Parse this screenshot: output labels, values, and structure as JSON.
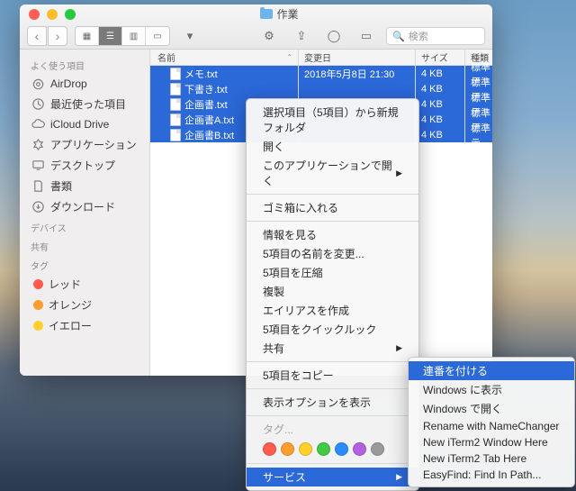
{
  "window": {
    "title": "作業"
  },
  "search": {
    "placeholder": "検索"
  },
  "sidebar": {
    "sections": [
      {
        "header": "よく使う項目",
        "items": [
          {
            "label": "AirDrop"
          },
          {
            "label": "最近使った項目"
          },
          {
            "label": "iCloud Drive"
          },
          {
            "label": "アプリケーション"
          },
          {
            "label": "デスクトップ"
          },
          {
            "label": "書類"
          },
          {
            "label": "ダウンロード"
          }
        ]
      },
      {
        "header": "デバイス",
        "items": []
      },
      {
        "header": "共有",
        "items": []
      },
      {
        "header": "タグ",
        "items": [
          {
            "label": "レッド",
            "color": "#ff5c4d"
          },
          {
            "label": "オレンジ",
            "color": "#ff9d2e"
          },
          {
            "label": "イエロー",
            "color": "#ffd02e"
          }
        ]
      }
    ]
  },
  "columns": {
    "name": "名前",
    "date": "変更日",
    "size": "サイズ",
    "kind": "種類"
  },
  "files": [
    {
      "name": "メモ.txt",
      "date": "2018年5月8日 21:30",
      "size": "4 KB",
      "kind": "標準テ"
    },
    {
      "name": "下書き.txt",
      "date": "",
      "size": "4 KB",
      "kind": "標準テ"
    },
    {
      "name": "企画書.txt",
      "date": "",
      "size": "4 KB",
      "kind": "標準テ"
    },
    {
      "name": "企画書A.txt",
      "date": "",
      "size": "4 KB",
      "kind": "標準テ"
    },
    {
      "name": "企画書B.txt",
      "date": "",
      "size": "4 KB",
      "kind": "標準テ"
    }
  ],
  "contextMenu": {
    "items": [
      {
        "label": "選択項目（5項目）から新規フォルダ",
        "type": "item"
      },
      {
        "label": "開く",
        "type": "item"
      },
      {
        "label": "このアプリケーションで開く",
        "type": "submenu"
      },
      {
        "type": "sep"
      },
      {
        "label": "ゴミ箱に入れる",
        "type": "item"
      },
      {
        "type": "sep"
      },
      {
        "label": "情報を見る",
        "type": "item"
      },
      {
        "label": "5項目の名前を変更...",
        "type": "item"
      },
      {
        "label": "5項目を圧縮",
        "type": "item"
      },
      {
        "label": "複製",
        "type": "item"
      },
      {
        "label": "エイリアスを作成",
        "type": "item"
      },
      {
        "label": "5項目をクイックルック",
        "type": "item"
      },
      {
        "label": "共有",
        "type": "submenu"
      },
      {
        "type": "sep"
      },
      {
        "label": "5項目をコピー",
        "type": "item"
      },
      {
        "type": "sep"
      },
      {
        "label": "表示オプションを表示",
        "type": "item"
      },
      {
        "type": "sep"
      },
      {
        "label": "タグ...",
        "type": "item",
        "disabled": true
      },
      {
        "type": "tags",
        "colors": [
          "#ff5c4d",
          "#ff9d2e",
          "#ffd02e",
          "#42c945",
          "#2b8cff",
          "#b260e0",
          "#9a9a9a"
        ]
      },
      {
        "type": "sep"
      },
      {
        "label": "サービス",
        "type": "submenu",
        "highlighted": true
      }
    ]
  },
  "submenu": {
    "items": [
      {
        "label": "連番を付ける",
        "highlighted": true
      },
      {
        "label": "Windows に表示"
      },
      {
        "label": "Windows で開く"
      },
      {
        "label": "Rename with NameChanger"
      },
      {
        "label": "New iTerm2 Window Here"
      },
      {
        "label": "New iTerm2 Tab Here"
      },
      {
        "label": "EasyFind: Find In Path..."
      }
    ]
  }
}
